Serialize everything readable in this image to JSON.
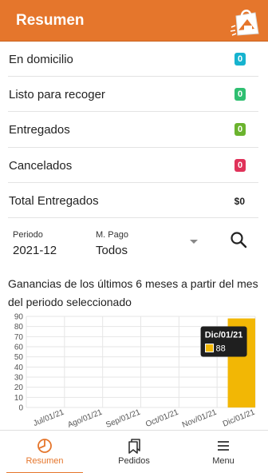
{
  "header": {
    "title": "Resumen"
  },
  "summary": [
    {
      "label": "En domicilio",
      "badge": "0",
      "color": "#16b3cf"
    },
    {
      "label": "Listo para recoger",
      "badge": "0",
      "color": "#2fbf71"
    },
    {
      "label": "Entregados",
      "badge": "0",
      "color": "#6bb32e"
    },
    {
      "label": "Cancelados",
      "badge": "0",
      "color": "#e0325a"
    }
  ],
  "total": {
    "label": "Total Entregados",
    "value": "$0"
  },
  "filters": {
    "period_label": "Periodo",
    "period_value": "2021-12",
    "payment_label": "M. Pago",
    "payment_value": "Todos"
  },
  "chart_title": "Ganancias de los últimos 6 meses a partir del mes del periodo seleccionado",
  "chart_data": {
    "type": "bar",
    "categories": [
      "Jul/01/21",
      "Ago/01/21",
      "Sep/01/21",
      "Oct/01/21",
      "Nov/01/21",
      "Dic/01/21"
    ],
    "values": [
      0,
      0,
      0,
      0,
      0,
      88
    ],
    "ylim": [
      0,
      90
    ],
    "yticks": [
      0,
      10,
      20,
      30,
      40,
      50,
      60,
      70,
      80,
      90
    ],
    "grid": true,
    "bar_color": "#f2b705",
    "tooltip": {
      "title": "Dic/01/21",
      "value": "88"
    }
  },
  "nav": [
    {
      "label": "Resumen",
      "icon": "pie-chart-icon",
      "active": true
    },
    {
      "label": "Pedidos",
      "icon": "bookmarks-icon",
      "active": false
    },
    {
      "label": "Menu",
      "icon": "hamburger-menu-icon",
      "active": false
    }
  ],
  "colors": {
    "accent": "#e5762c"
  }
}
